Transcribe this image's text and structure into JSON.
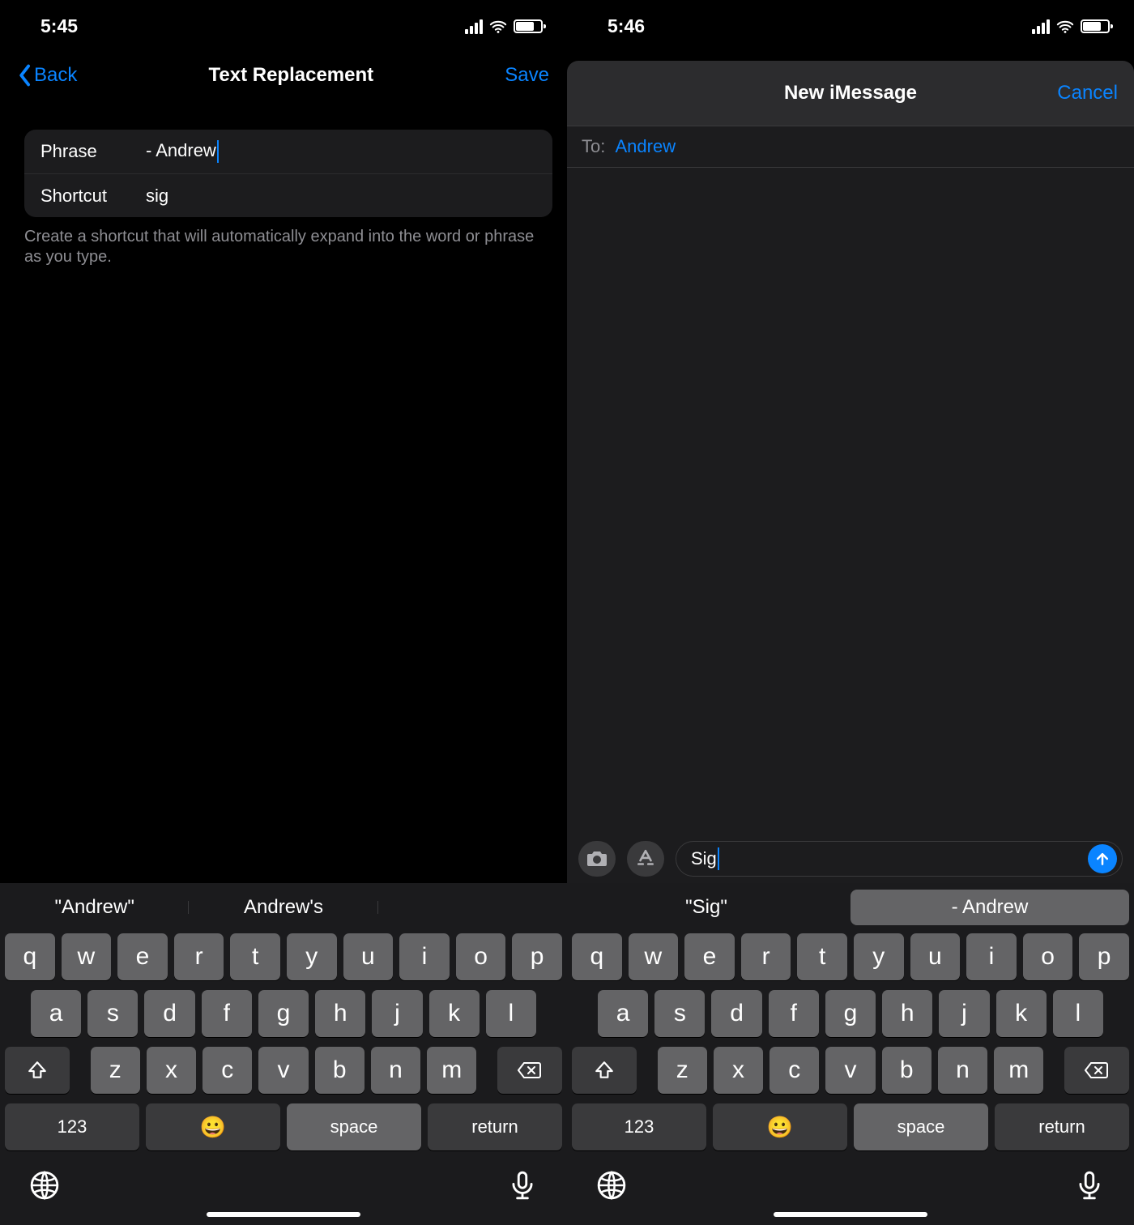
{
  "left": {
    "status": {
      "time": "5:45"
    },
    "nav": {
      "back": "Back",
      "title": "Text Replacement",
      "save": "Save"
    },
    "form": {
      "phrase_label": "Phrase",
      "phrase_value": "- Andrew",
      "shortcut_label": "Shortcut",
      "shortcut_value": "sig"
    },
    "footer": "Create a shortcut that will automatically expand into the word or phrase as you type.",
    "suggest": [
      "\"Andrew\"",
      "Andrew's",
      ""
    ]
  },
  "right": {
    "status": {
      "time": "5:46"
    },
    "header": {
      "title": "New iMessage",
      "cancel": "Cancel"
    },
    "to": {
      "label": "To:",
      "value": "Andrew"
    },
    "compose": {
      "value": "Sig"
    },
    "suggest": [
      "\"Sig\"",
      "- Andrew"
    ]
  },
  "keyboard": {
    "row1": [
      "q",
      "w",
      "e",
      "r",
      "t",
      "y",
      "u",
      "i",
      "o",
      "p"
    ],
    "row2": [
      "a",
      "s",
      "d",
      "f",
      "g",
      "h",
      "j",
      "k",
      "l"
    ],
    "row3": [
      "z",
      "x",
      "c",
      "v",
      "b",
      "n",
      "m"
    ],
    "k123": "123",
    "space": "space",
    "return": "return"
  }
}
